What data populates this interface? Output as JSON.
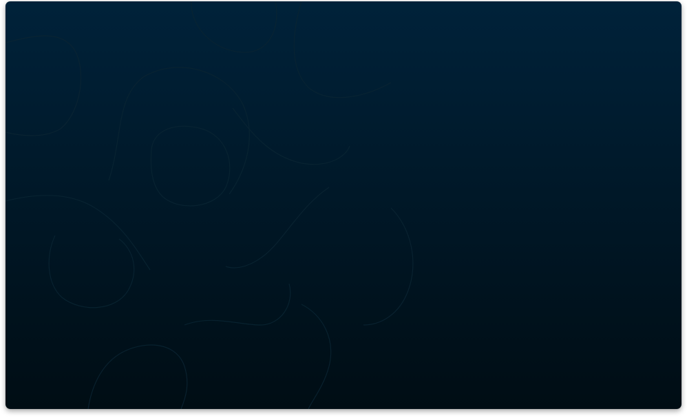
{
  "desktop": {
    "background": {
      "gradient_top": "#00223a",
      "gradient_bottom": "#000d14",
      "pattern": "topographic-contour-lines",
      "line_color": "#0a2533"
    }
  }
}
